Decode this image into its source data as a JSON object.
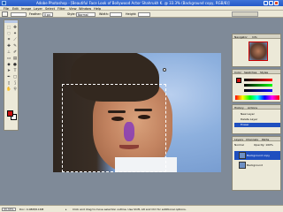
{
  "window": {
    "title": "Adobe Photoshop - [Beautiful Face Look of Bollywood Actor Shahrukh K..@ 33.3% (Background copy, RGB/8)]"
  },
  "menu": [
    "File",
    "Edit",
    "Image",
    "Layer",
    "Select",
    "Filter",
    "View",
    "Window",
    "Help"
  ],
  "options": {
    "feather_label": "Feather:",
    "feather_value": "0 px",
    "style_label": "Style:",
    "style_value": "Normal",
    "width_label": "Width:",
    "height_label": "Height:"
  },
  "navigator": {
    "tabs": [
      "Navigator",
      "Info"
    ]
  },
  "color_panel": {
    "tabs": [
      "Color",
      "Swatches",
      "Styles"
    ],
    "fg_color": "#c80d0d"
  },
  "history": {
    "tabs": [
      "History",
      "Actions"
    ],
    "items": [
      "New Layer",
      "Delete Layer",
      "Eraser"
    ]
  },
  "layers": {
    "tabs": [
      "Layers",
      "Channels",
      "Paths"
    ],
    "blend_mode": "Normal",
    "opacity": "Opacity: 100%",
    "rows": [
      "Background copy",
      "Background"
    ]
  },
  "status": {
    "zoom": "33.33%",
    "doc": "Doc: 4.08M/8.16M",
    "tip": "Click and drag to move selection outline. Use Shift, Alt and Ctrl for additional options."
  },
  "colors": {
    "foreground": "#c80d0d",
    "background": "#ffffff",
    "titlebar": "#2459c8",
    "selection": "#1f4fbf"
  }
}
